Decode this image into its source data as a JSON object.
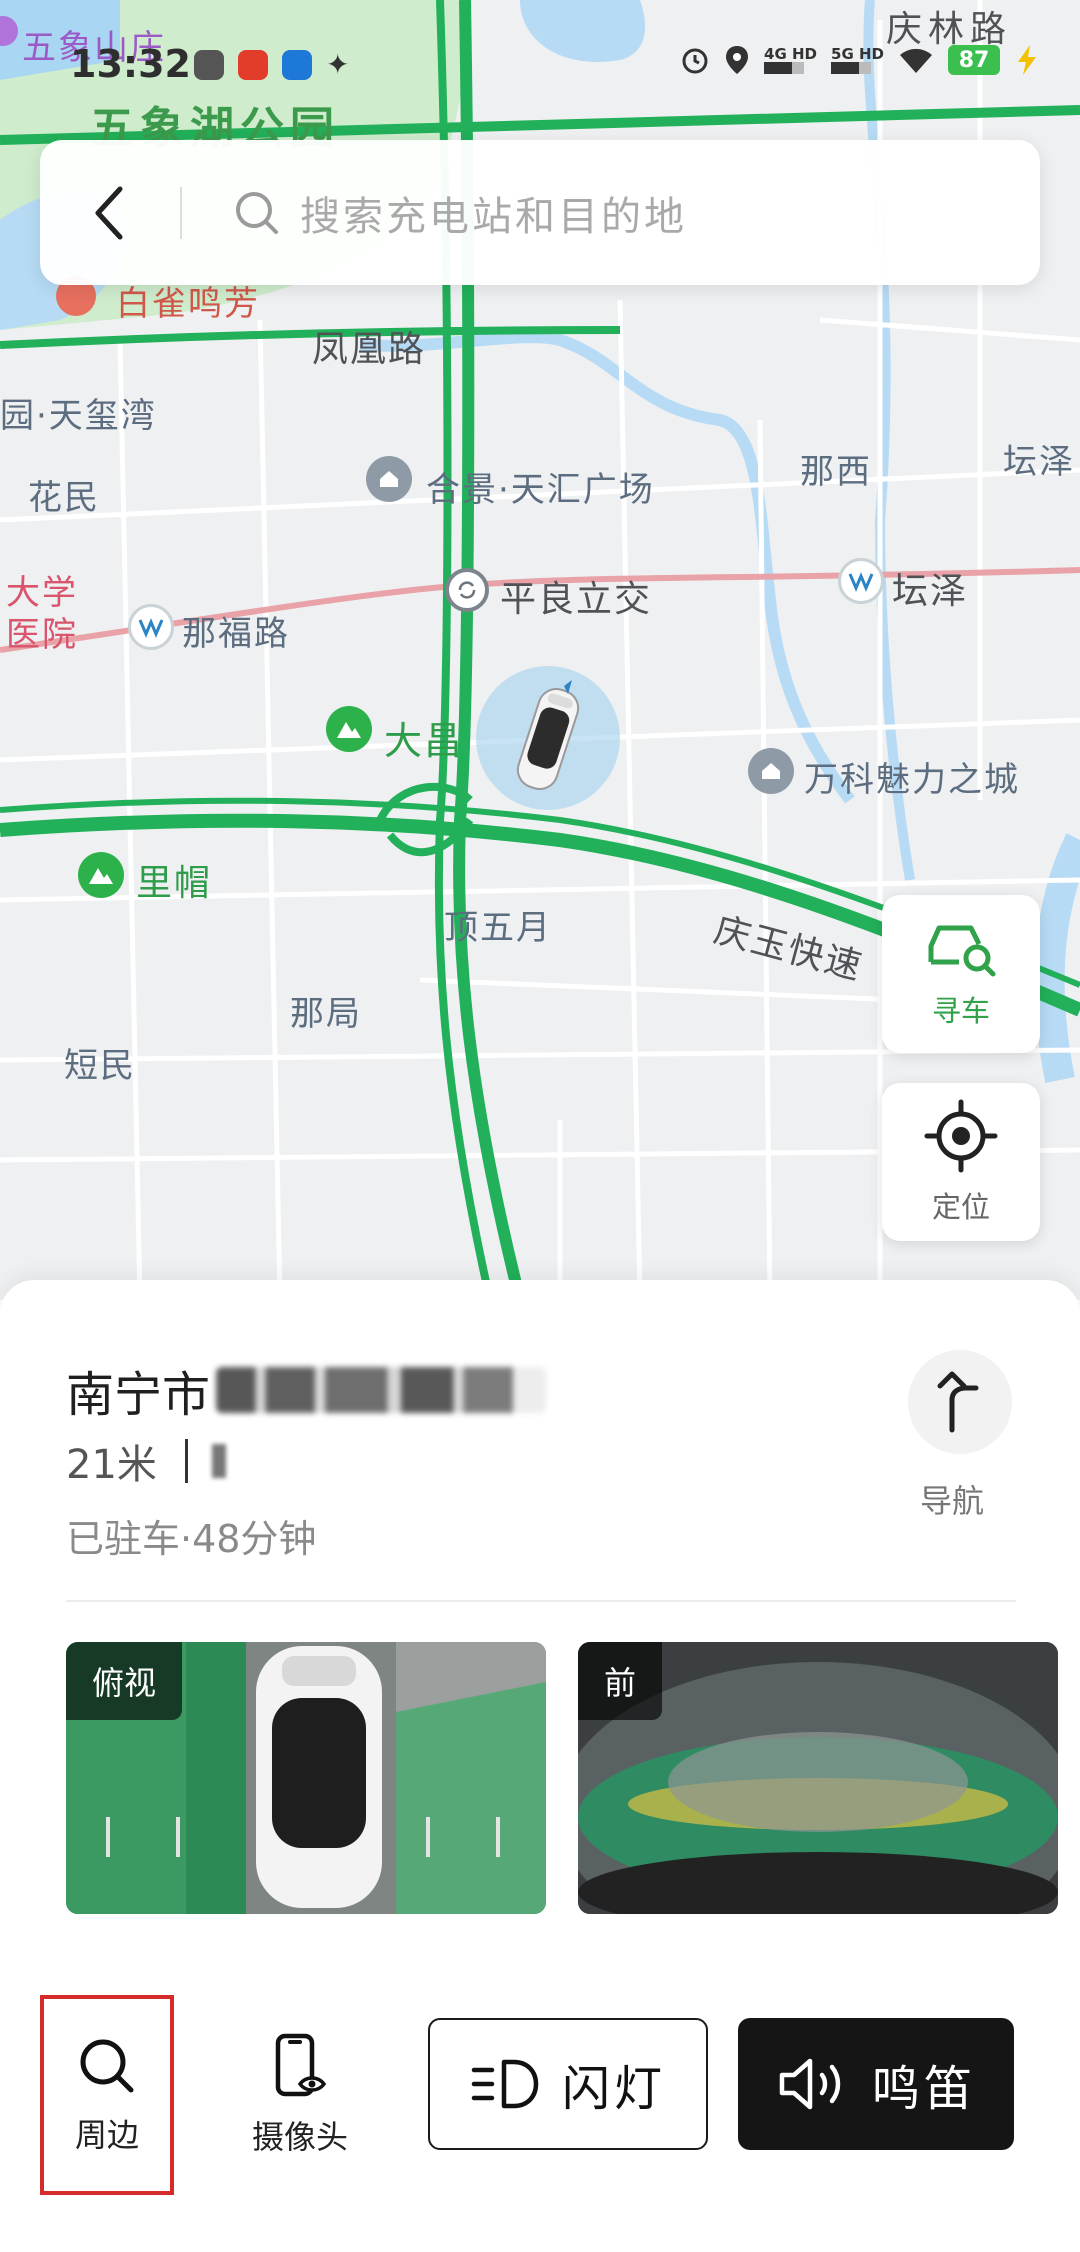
{
  "status_bar": {
    "time": "13:32",
    "signal_1": "4G HD",
    "signal_2": "5G HD",
    "battery": "87",
    "icons": [
      "alarm-icon",
      "location-icon",
      "wifi-icon",
      "charging-icon"
    ]
  },
  "search": {
    "placeholder": "搜索充电站和目的地"
  },
  "map": {
    "labels": {
      "wuxiang_shanzhuang": "五象山庄",
      "wuxiang_lake_park": "五象湖公园",
      "baique_mingfang": "白雀鸣芳",
      "fenghuang_road": "凤凰路",
      "tianxi_bay": "园·天玺湾",
      "huamin": "花民",
      "hejing_plaza": "合景·天汇广场",
      "naxi": "那西",
      "tanze_right": "坛泽",
      "university_hospital": "大学\n医院",
      "pingliang_interchange": "平良立交",
      "tanze_station": "坛泽",
      "nafu_road": "那福路",
      "dachang": "大昌",
      "vanke_city": "万科魅力之城",
      "limao": "里帽",
      "dingwuyue": "顶五月",
      "qingyu_expressway": "庆玉快速",
      "naju": "那局",
      "duanmin": "短民",
      "qinglin_road": "庆林路"
    }
  },
  "map_buttons": {
    "find_car": "寻车",
    "locate": "定位"
  },
  "vehicle": {
    "city": "南宁市",
    "distance": "21米",
    "parked_status": "已驻车·48分钟",
    "navigate": "导航"
  },
  "cameras": {
    "top_view": "俯视",
    "front_view": "前"
  },
  "actions": {
    "surroundings": "周边",
    "camera": "摄像头",
    "flash_lights": "闪灯",
    "horn": "鸣笛"
  },
  "colors": {
    "accent_green": "#2fa24a",
    "road_green": "#22b05a",
    "highlight_red": "#d62b2b"
  }
}
